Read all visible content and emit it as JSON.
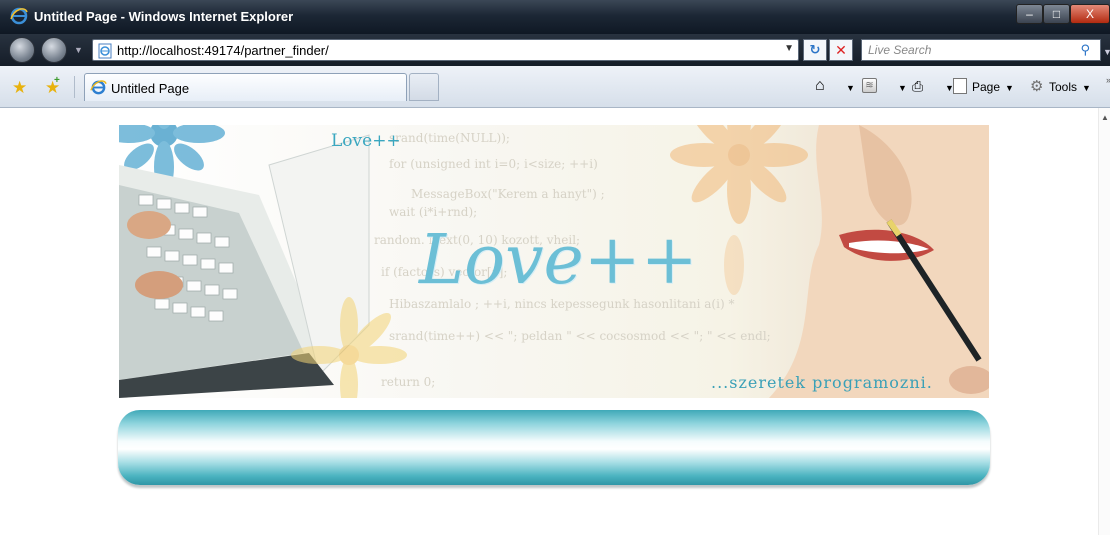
{
  "window": {
    "title": "Untitled Page - Windows Internet Explorer",
    "controls": {
      "minimize": "–",
      "maximize": "□",
      "close": "X"
    }
  },
  "navigation": {
    "address": "http://localhost:49174/partner_finder/",
    "search_placeholder": "Live Search",
    "refresh_icon": "refresh-icon",
    "stop_icon": "stop-icon"
  },
  "tabs": [
    {
      "label": "Untitled Page",
      "active": true
    }
  ],
  "command_bar": {
    "page_label": "Page",
    "tools_label": "Tools"
  },
  "banner": {
    "logo_small": "Love++",
    "logo_big": "Love++",
    "tagline": "...szeretek programozni.",
    "code_lines": [
      "srand(time(NULL));",
      "for (unsigned int i=0; i<size; ++i)",
      "MessageBox(\"Kerem a hanyt\") ;",
      "wait (i*i+rnd);",
      "random. Next(0, 10) kozott, vheil;",
      "if (factors) vector[a];",
      "Hibaszamlalo ; ++i, nincs kepessegunk hasonlitani a(i) * ",
      "srand(time++) << \"; peldan \" << cocsosmod << \"; \" << endl;",
      "return 0;"
    ]
  },
  "colors": {
    "brand": "#3aa7c0",
    "band": "#4bb3c0"
  }
}
